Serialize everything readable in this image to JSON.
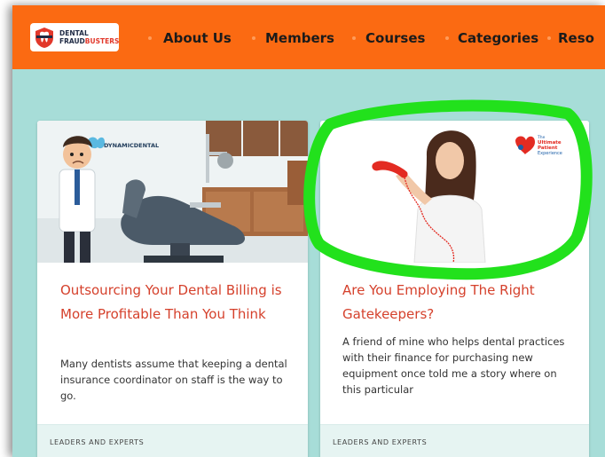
{
  "logo": {
    "line1": "DENTAL",
    "line2a": "FRAUD",
    "line2b": "BUSTERS"
  },
  "nav": {
    "items": [
      "About Us",
      "Members",
      "Courses",
      "Categories",
      "Reso"
    ]
  },
  "cards": [
    {
      "image_brand": "DYNAMICDENTAL",
      "title": "Outsourcing Your Dental Billing is More Profitable Than You Think",
      "excerpt": "Many dentists assume that keeping a dental insurance coordinator on staff is the way to go.",
      "tag": "LEADERS AND EXPERTS"
    },
    {
      "image_brand": [
        "The",
        "Ultimate",
        "Patient",
        "Experience"
      ],
      "title": "Are You Employing The Right Gatekeepers?",
      "excerpt": "A friend of mine who helps dental practices with their finance for purchasing new equipment once told me a story where on this particular",
      "tag": "LEADERS AND EXPERTS"
    }
  ],
  "colors": {
    "nav_bg": "#fb6a12",
    "page_bg": "#a7ddd8",
    "title": "#d5412c",
    "highlight": "#22e11c"
  }
}
